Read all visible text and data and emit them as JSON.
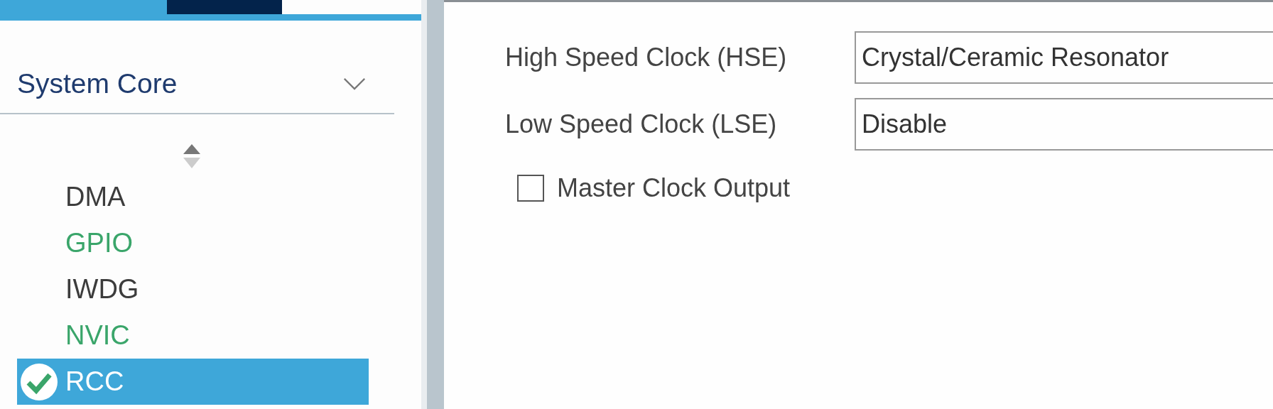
{
  "tabs": [
    {
      "selected": true
    },
    {
      "selected": false
    }
  ],
  "category": {
    "title": "System Core",
    "expanded": true
  },
  "items": [
    {
      "label": "DMA",
      "color": "#3c3c3c",
      "selected": false,
      "configured": false
    },
    {
      "label": "GPIO",
      "color": "#3aa56a",
      "selected": false,
      "configured": false
    },
    {
      "label": "IWDG",
      "color": "#3c3c3c",
      "selected": false,
      "configured": false
    },
    {
      "label": "NVIC",
      "color": "#3aa56a",
      "selected": false,
      "configured": false
    },
    {
      "label": "RCC",
      "color": "#ffffff",
      "selected": true,
      "configured": true
    }
  ],
  "settings": [
    {
      "label": "High Speed Clock (HSE)",
      "value": "Crystal/Ceramic Resonator"
    },
    {
      "label": "Low Speed Clock (LSE)",
      "value": "Disable"
    }
  ],
  "master_clock_output": {
    "label": "Master Clock Output",
    "checked": false
  }
}
